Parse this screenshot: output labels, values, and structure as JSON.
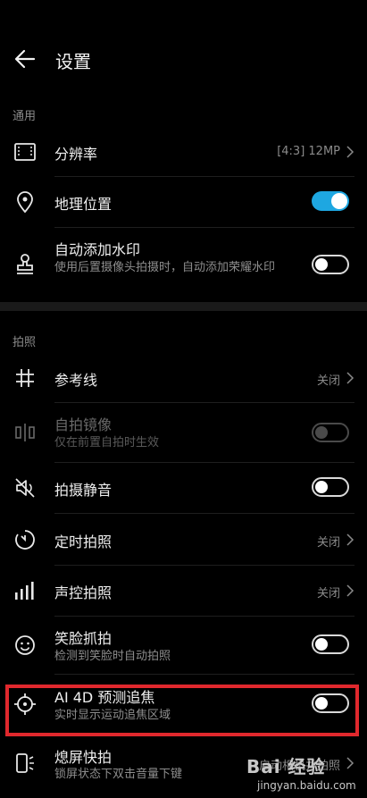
{
  "header": {
    "title": "设置",
    "back_icon": "arrow-left-icon"
  },
  "sections": {
    "general": "通用",
    "capture": "拍照"
  },
  "rows": {
    "resolution": {
      "title": "分辨率",
      "value": "[4:3] 12MP",
      "icon": "resolution-frame-icon"
    },
    "location": {
      "title": "地理位置",
      "toggle": "on",
      "icon": "location-pin-icon"
    },
    "watermark": {
      "title": "自动添加水印",
      "subtitle": "使用后置摄像头拍摄时，自动添加荣耀水印",
      "toggle": "off",
      "icon": "stamp-icon"
    },
    "gridlines": {
      "title": "参考线",
      "value": "关闭",
      "icon": "grid-hash-icon"
    },
    "mirror": {
      "title": "自拍镜像",
      "subtitle": "仅在前置自拍时生效",
      "toggle": "disabled",
      "icon": "mirror-icon"
    },
    "mute": {
      "title": "拍摄静音",
      "toggle": "off",
      "icon": "speaker-mute-icon"
    },
    "timer": {
      "title": "定时拍照",
      "value": "关闭",
      "icon": "timer-icon"
    },
    "voice": {
      "title": "声控拍照",
      "value": "关闭",
      "icon": "signal-bars-icon"
    },
    "smile": {
      "title": "笑脸抓拍",
      "subtitle": "检测到笑脸时自动拍照",
      "toggle": "off",
      "icon": "smiley-icon"
    },
    "tracking": {
      "title": "AI 4D 预测追焦",
      "subtitle": "实时显示运动追焦区域",
      "toggle": "off",
      "icon": "crosshair-icon"
    },
    "snapshot": {
      "title": "熄屏快拍",
      "subtitle": "锁屏状态下双击音量下键",
      "value": "启动相机并拍照",
      "icon": "phone-snap-icon"
    }
  },
  "colors": {
    "accent": "#1ea7e1",
    "highlight": "#e0282d",
    "background": "#000000"
  },
  "watermark_overlay": {
    "logo": "Bai 经验",
    "url": "jingyan.baidu.com"
  }
}
